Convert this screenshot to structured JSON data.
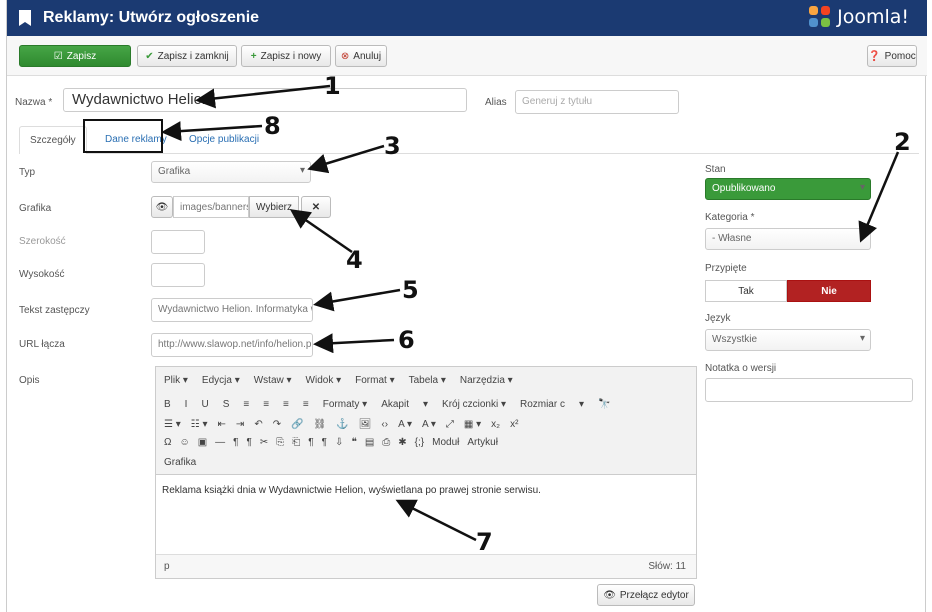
{
  "header": {
    "title": "Reklamy: Utwórz ogłoszenie",
    "logo": "Joomla!"
  },
  "toolbar": {
    "save": "Zapisz",
    "save_close": "Zapisz i zamknij",
    "save_new": "Zapisz i nowy",
    "cancel": "Anuluj",
    "help": "Pomoc"
  },
  "form": {
    "name_label": "Nazwa *",
    "name_value": "Wydawnictwo Helion",
    "alias_label": "Alias",
    "alias_placeholder": "Generuj z tytułu"
  },
  "tabs": [
    "Szczegóły",
    "Dane reklamy",
    "Opcje publikacji"
  ],
  "details": {
    "type_label": "Typ",
    "type_value": "Grafika",
    "image_label": "Grafika",
    "image_path": "images/banners",
    "image_select": "Wybierz",
    "image_clear": "✕",
    "width_label": "Szerokość",
    "height_label": "Wysokość",
    "alt_label": "Tekst zastępczy",
    "alt_value": "Wydawnictwo Helion. Informatyka w",
    "url_label": "URL łącza",
    "url_value": "http://www.slawop.net/info/helion.ph",
    "desc_label": "Opis"
  },
  "editor": {
    "menu": [
      "Plik ▾",
      "Edycja ▾",
      "Wstaw ▾",
      "Widok ▾",
      "Format ▾",
      "Tabela ▾",
      "Narzędzia ▾"
    ],
    "toolbar1": [
      "B",
      "I",
      "U",
      "S",
      "≡",
      "≡",
      "≡",
      "≡",
      "Formaty ▾",
      "Akapit",
      "▾",
      "Krój czcionki ▾",
      "Rozmiar c",
      "▾",
      "🔭"
    ],
    "toolbar2": [
      "☰ ▾",
      "☷ ▾",
      "⇤",
      "⇥",
      "↶",
      "↷",
      "🔗",
      "⛓",
      "⚓",
      "🖼",
      "‹›",
      "A ▾",
      "A ▾",
      "⤢",
      "▦ ▾",
      "x₂",
      "x²"
    ],
    "toolbar3": [
      "Ω",
      "☺",
      "▣",
      "—",
      "¶",
      "¶",
      "✂",
      "⎘",
      "⎗",
      "¶",
      "¶",
      "⇩",
      "❝",
      "▤",
      "⎙",
      "✱",
      "{;}",
      "Moduł",
      "Artykuł"
    ],
    "toolbar4": [
      "Grafika"
    ],
    "content": "Reklama książki dnia w Wydawnictwie Helion, wyświetlana po prawej stronie serwisu.",
    "status_path": "p",
    "word_count": "Słów: 11",
    "toggle_button": "Przełącz edytor"
  },
  "sidebar": {
    "status_label": "Stan",
    "status_value": "Opublikowano",
    "category_label": "Kategoria *",
    "category_value": "- Własne",
    "pinned_label": "Przypięte",
    "pinned_yes": "Tak",
    "pinned_no": "Nie",
    "language_label": "Język",
    "language_value": "Wszystkie",
    "version_note_label": "Notatka o wersji"
  },
  "annotations": [
    "1",
    "2",
    "3",
    "4",
    "5",
    "6",
    "7",
    "8"
  ],
  "colors": {
    "header": "#1b3a72",
    "save_green": "#3a9a3a",
    "no_red": "#b22222",
    "link": "#2a6fb3"
  }
}
